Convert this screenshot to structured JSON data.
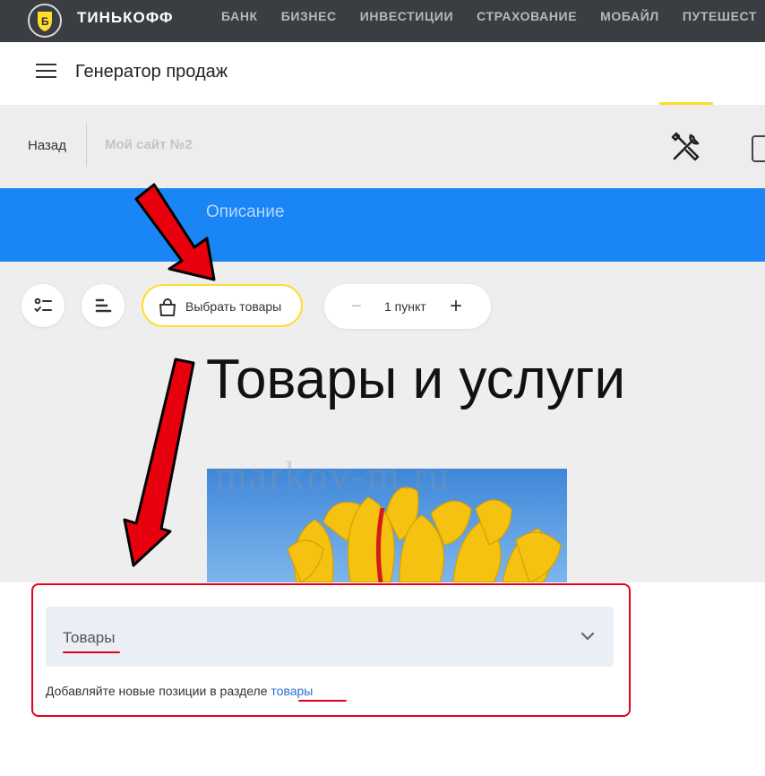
{
  "topbar": {
    "brand": "ТИНЬКОФФ",
    "nav": [
      "БАНК",
      "БИЗНЕС",
      "ИНВЕСТИЦИИ",
      "СТРАХОВАНИЕ",
      "МОБАЙЛ",
      "ПУТЕШЕСТ"
    ]
  },
  "header": {
    "title": "Генератор продаж"
  },
  "subbar": {
    "back_label": "Назад",
    "site_name": "Мой сайт №2"
  },
  "banner": {
    "title": "Описание"
  },
  "toolbar": {
    "pick_label": "Выбрать товары",
    "count_label": "1 пункт",
    "minus": "−",
    "plus": "+"
  },
  "block": {
    "heading": "Товары и услуги"
  },
  "watermark": "markov-m.ru",
  "panel": {
    "select_value": "Товары",
    "hint_prefix": "Добавляйте новые позиции в разделе ",
    "hint_link": "товары"
  },
  "colors": {
    "accent_yellow": "#ffdd2d",
    "banner_blue": "#1a86f5",
    "annotation_red": "#e3001b",
    "link_blue": "#2d6fd3"
  }
}
